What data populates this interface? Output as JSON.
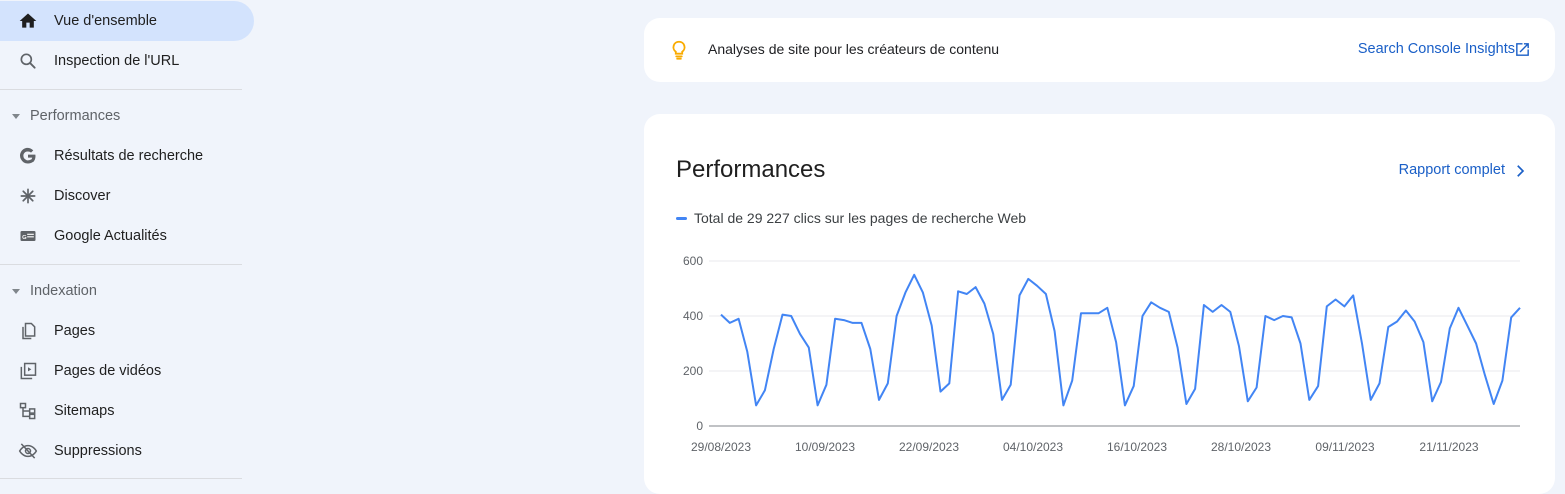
{
  "sidebar": {
    "overview": {
      "label": "Vue d'ensemble",
      "icon": "home-icon"
    },
    "url_inspection": {
      "label": "Inspection de l'URL",
      "icon": "search-icon"
    },
    "performance_section": {
      "label": "Performances"
    },
    "performance_items": [
      {
        "label": "Résultats de recherche",
        "icon": "google-g-icon"
      },
      {
        "label": "Discover",
        "icon": "asterisk-icon"
      },
      {
        "label": "Google Actualités",
        "icon": "news-icon"
      }
    ],
    "indexing_section": {
      "label": "Indexation"
    },
    "indexing_items": [
      {
        "label": "Pages",
        "icon": "pages-icon"
      },
      {
        "label": "Pages de vidéos",
        "icon": "video-pages-icon"
      },
      {
        "label": "Sitemaps",
        "icon": "sitemap-icon"
      },
      {
        "label": "Suppressions",
        "icon": "eye-off-icon"
      }
    ]
  },
  "insights_card": {
    "text": "Analyses de site pour les créateurs de contenu",
    "link": "Search Console Insights",
    "icon": "lightbulb-icon"
  },
  "performance_card": {
    "title": "Performances",
    "report_link": "Rapport complet",
    "legend": "Total de 29 227 clics sur les pages de recherche Web"
  },
  "colors": {
    "accent": "#1a5fc7",
    "series": "#4285f4",
    "active_nav": "#d3e3fd",
    "bulb": "#f9ab00"
  },
  "chart_data": {
    "type": "line",
    "x_tick_labels": [
      "29/08/2023",
      "10/09/2023",
      "22/09/2023",
      "04/10/2023",
      "16/10/2023",
      "28/10/2023",
      "09/11/2023",
      "21/11/2023"
    ],
    "y_tick_labels": [
      "0",
      "200",
      "400",
      "600"
    ],
    "ylim": [
      0,
      600
    ],
    "grid": true,
    "series": [
      {
        "name": "Total de 29 227 clics sur les pages de recherche Web",
        "values": [
          405,
          375,
          390,
          270,
          75,
          130,
          280,
          405,
          400,
          335,
          285,
          75,
          150,
          390,
          385,
          375,
          375,
          280,
          95,
          155,
          400,
          485,
          550,
          485,
          365,
          125,
          155,
          490,
          480,
          505,
          445,
          335,
          95,
          150,
          475,
          535,
          510,
          480,
          345,
          75,
          165,
          410,
          410,
          410,
          430,
          305,
          75,
          145,
          400,
          450,
          430,
          415,
          285,
          80,
          135,
          440,
          415,
          440,
          415,
          290,
          90,
          140,
          400,
          385,
          400,
          395,
          300,
          95,
          145,
          435,
          460,
          435,
          475,
          300,
          95,
          155,
          360,
          380,
          420,
          380,
          305,
          90,
          160,
          355,
          430,
          365,
          300,
          185,
          80,
          165,
          395,
          430
        ]
      }
    ]
  }
}
